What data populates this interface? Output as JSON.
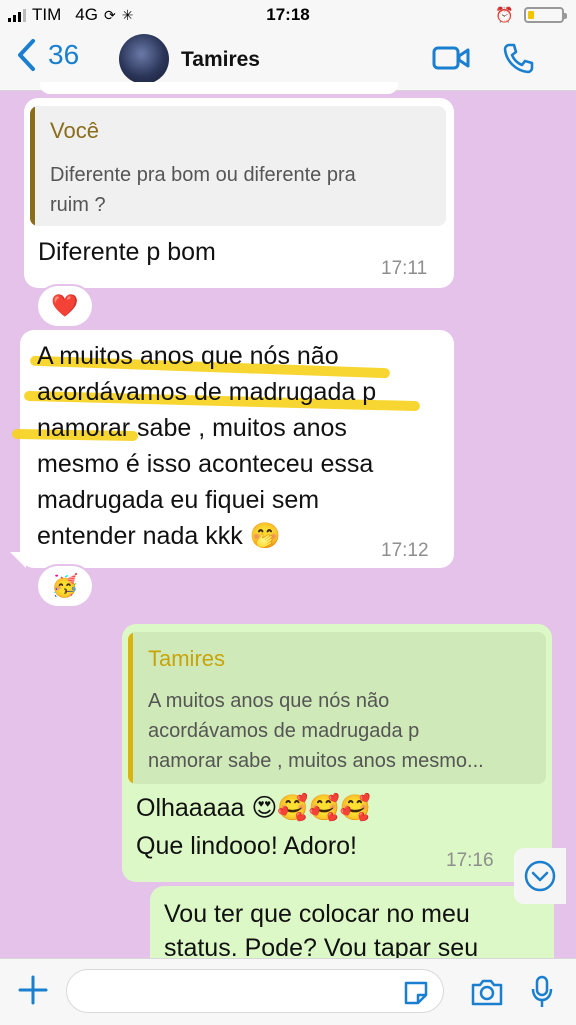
{
  "status_bar": {
    "carrier": "TIM",
    "network": "4G",
    "time": "17:18"
  },
  "header": {
    "back_count": "36",
    "contact_name": "Tamires"
  },
  "messages": {
    "m1": {
      "quote_author": "Você",
      "quote_text_1": "Diferente pra bom ou diferente pra",
      "quote_text_2": "ruim ?",
      "text": "Diferente p bom",
      "time": "17:11",
      "reaction": "❤️"
    },
    "m2": {
      "lines": [
        "A muitos anos que nós não",
        "acordávamos de madrugada p",
        "namorar sabe , muitos anos",
        "mesmo é isso aconteceu essa",
        "madrugada eu fiquei sem",
        "entender nada kkk 🤭"
      ],
      "time": "17:12",
      "reaction": "🥳"
    },
    "m3": {
      "quote_author": "Tamires",
      "quote_text_1": "A muitos anos que nós não",
      "quote_text_2": "acordávamos de madrugada p",
      "quote_text_3": "namorar sabe , muitos anos mesmo...",
      "line_1": "Olhaaaaa 😍🥰🥰🥰",
      "line_2": "Que lindooo! Adoro!",
      "time": "17:16"
    },
    "m4": {
      "line_1": "Vou ter que colocar no meu",
      "line_2": "status. Pode? Vou tapar seu"
    }
  },
  "composer": {
    "placeholder": ""
  },
  "colors": {
    "background": "#e4c2ea",
    "incoming": "#ffffff",
    "outgoing": "#dcf8c6",
    "accent": "#1a7fcf",
    "quote_bar_in": "#8a6d1a",
    "quote_bar_out": "#d9b30f",
    "highlight": "#f7d21b"
  },
  "icons": [
    "back-chevron-icon",
    "video-call-icon",
    "phone-icon",
    "scroll-down-icon",
    "plus-icon",
    "sticker-icon",
    "camera-icon",
    "mic-icon",
    "alarm-icon",
    "battery-icon"
  ]
}
